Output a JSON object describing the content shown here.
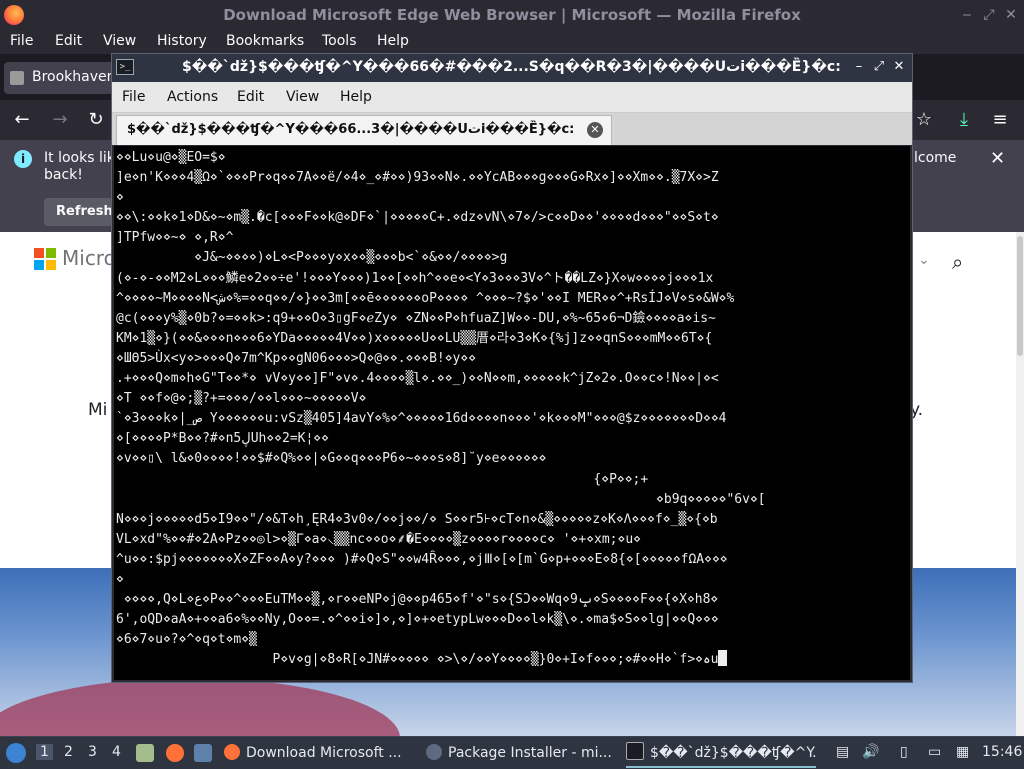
{
  "firefox": {
    "window_title": "Download Microsoft Edge Web Browser | Microsoft — Mozilla Firefox",
    "menu": [
      "File",
      "Edit",
      "View",
      "History",
      "Bookmarks",
      "Tools",
      "Help"
    ],
    "tab_label": "Brookhaven",
    "notice": {
      "message": "It looks lik back!",
      "trailing": "lcome",
      "refresh_label": "Refresh"
    },
    "page": {
      "brand": "Micro",
      "body_start": "Mi",
      "body_end": "y."
    }
  },
  "terminal": {
    "title": "$��`dž}$���ʧ�^Y���66�#���2...S�q��R�3�|����Uتi���Ȅ}�c:",
    "menu": [
      "File",
      "Actions",
      "Edit",
      "View",
      "Help"
    ],
    "tab_label": "$��`dž}$���ʧ�^Y���66...3�|����Uتi���Ȅ}�c:",
    "lines": [
      "⋄⋄Lu⋄u@⋄▒EO=$⋄",
      "]e⋄n'K⋄⋄⋄4▒Ω⋄`⋄⋄⋄Pr⋄q⋄⋄7A⋄⋄ë/⋄4⋄_⋄#⋄⋄)93⋄⋄N⋄.⋄⋄YcAB⋄⋄⋄g⋄⋄⋄G⋄Rx⋄]⋄⋄Xm⋄⋄.▒7X⋄>Z",
      "⋄",
      "⋄⋄\\:⋄⋄k⋄1⋄D&⋄~⋄m▒.�c[⋄⋄⋄F⋄⋄k@⋄DF⋄`|⋄⋄⋄⋄⋄C+.⋄dz⋄vN\\⋄7⋄/>c⋄⋄D⋄⋄'⋄⋄⋄⋄d⋄⋄⋄\"⋄⋄S⋄t⋄",
      "]TPfw⋄⋄~⋄ ⋄,R⋄^",
      "          ⋄J&~⋄⋄⋄⋄)⋄L⋄<P⋄⋄⋄y⋄x⋄⋄▒⋄⋄⋄b<`⋄&⋄⋄/⋄⋄⋄⋄>g",
      "(⋄-⋄-⋄⋄M2⋄L⋄⋄⋄鱗e⋄2⋄⋄÷e'!⋄⋄⋄Y⋄⋄⋄)1⋄⋄[⋄⋄h^⋄⋄e⋄<Y⋄3⋄⋄⋄3V⋄^ト��LZ⋄}X⋄w⋄⋄⋄⋄j⋄⋄⋄1x",
      "^⋄⋄⋄⋄~M⋄⋄⋄⋄N<ش⋄%=⋄⋄q⋄⋄/⋄}⋄⋄3m[⋄⋄ē⋄⋄⋄⋄⋄⋄oP⋄⋄⋄⋄ ^⋄⋄⋄~?$⋄'⋄⋄I MER⋄⋄^+RsÍJ⋄V⋄s⋄&W⋄%",
      "@c(⋄⋄⋄y%▒⋄0b?⋄=⋄⋄k>:q9+⋄⋄O⋄3▯gF⋄ℯZy⋄ ⋄ZN⋄⋄P⋄hfuaZ]W⋄⋄-DU,⋄%~65⋄6¬D鐱⋄⋄⋄⋄a⋄is~",
      "KM⋄1▒⋄}(⋄⋄&⋄⋄⋄n⋄⋄⋄6⋄YDa⋄⋄⋄⋄⋄4V⋄⋄)x⋄⋄⋄⋄⋄U⋄⋄LU▒▒厝⋄라⋄3⋄K⋄{%j]z⋄⋄qnS⋄⋄⋄mM⋄⋄6T⋄{",
      "⋄ШΘ5>Ùx<y⋄>⋄⋄⋄Q⋄7m^Kp⋄⋄gN06⋄⋄⋄>Q⋄@⋄⋄.⋄⋄⋄B!⋄y⋄⋄",
      ".+⋄⋄⋄Q⋄m⋄h⋄G\"T⋄⋄*⋄ vV⋄y⋄⋄]F\"⋄v⋄.4⋄⋄⋄⋄▒l⋄.⋄⋄_)⋄⋄N⋄⋄m,⋄⋄⋄⋄⋄k^jZ⋄2⋄.O⋄⋄c⋄!N⋄⋄|⋄<",
      "⋄T ⋄⋄f⋄@⋄;▒?+=⋄⋄⋄/⋄⋄l⋄⋄⋄~⋄⋄⋄⋄⋄V⋄",
      "`⋄3⋄⋄⋄k⋄|_ص Y⋄⋄⋄⋄⋄⋄u:vSz▒405]4avY⋄%⋄^⋄⋄⋄⋄⋄16d⋄⋄⋄⋄n⋄⋄⋄'⋄k⋄⋄⋄M\"⋄⋄⋄@$z⋄⋄⋄⋄⋄⋄⋄D⋄⋄4",
      "⋄[⋄⋄⋄⋄P*B⋄⋄?#⋄n5ڸUh⋄⋄2=K¦⋄⋄",
      "⋄v⋄⋄▯\\ l&⋄0⋄⋄⋄⋄!⋄⋄$#⋄Q%⋄⋄|⋄G⋄⋄q⋄⋄⋄P6⋄~⋄⋄⋄s⋄8]˘y⋄e⋄⋄⋄⋄⋄⋄",
      "                                                             {⋄P⋄⋄;+",
      "                                                                     ⋄b9q⋄⋄⋄⋄⋄\"6v⋄[",
      "N⋄⋄⋄j⋄⋄⋄⋄⋄d5⋄I9⋄⋄\"/⋄&T⋄h¸ĘR4⋄3v0⋄/⋄⋄j⋄⋄/⋄ S⋄⋄r5⊦⋄cT⋄n⋄&▒⋄⋄⋄⋄⋄z⋄K⋄Λ⋄⋄⋄f⋄_▒⋄{⋄b",
      "VL⋄xd\"%⋄⋄#⋄2A⋄Pz⋄⋄◎l>⋄▒Γ⋄a⋄⸜▒▒nc⋄⋄o⋄⸙�E⋄⋄⋄⋄▒z⋄⋄⋄⋄r⋄⋄⋄⋄c⋄ '⋄+⋄xm;⋄u⋄",
      "^u⋄⋄:$pj⋄⋄⋄⋄⋄⋄⋄X⋄ZF⋄⋄A⋄y?⋄⋄⋄ )#⋄Q⋄S\"⋄⋄w4Ȓ⋄⋄⋄,⋄jⅢ⋄[⋄[m`G⋄p+⋄⋄⋄E⋄8{⋄[⋄⋄⋄⋄⋄fΩA⋄⋄⋄",
      "⋄",
      " ⋄⋄⋄⋄,Q⋄L⋄ع⋄P⋄⋄^⋄⋄⋄EuTM⋄⋄▒,⋄r⋄⋄eNP⋄j@⋄⋄p465⋄f'⋄\"s⋄{SƆ⋄⋄Wq⋄9ݒ⋄S⋄⋄⋄⋄F⋄⋄{⋄X⋄h8⋄",
      "6',oQD⋄aA⋄+⋄⋄a6⋄%⋄⋄Ny,O⋄⋄=.⋄^⋄⋄i⋄]⋄,⋄]⋄+⋄etypLw⋄⋄⋄D⋄⋄l⋄k▒\\⋄.⋄ma$⋄S⋄⋄lg|⋄⋄Q⋄⋄⋄",
      "⋄6⋄7⋄u⋄?⋄^⋄q⋄t⋄m⋄▒",
      "                    P⋄v⋄g|⋄8⋄R[⋄JN#⋄⋄⋄⋄⋄ ⋄>\\⋄/⋄⋄Y⋄⋄⋄⋄▒}0⋄+I⋄f⋄⋄⋄;⋄#⋄⋄H⋄`f>⋄ہu"
    ]
  },
  "taskbar": {
    "workspaces": [
      "1",
      "2",
      "3",
      "4"
    ],
    "tasks": [
      {
        "label": "Download Microsoft ..."
      },
      {
        "label": "Package Installer - mi..."
      },
      {
        "label": "$��`dž}$���ʧ�^Y..."
      }
    ],
    "clock": "15:46"
  },
  "colors": {
    "terminal_bg": "#000000",
    "terminal_fg": "#ededed",
    "firefox_chrome": "#2b2a33",
    "taskbar_bg": "#2e3440"
  }
}
